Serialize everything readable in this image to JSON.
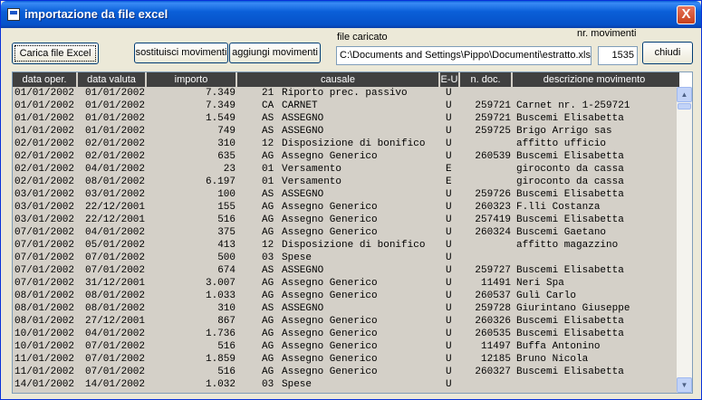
{
  "window": {
    "title": "importazione da file excel",
    "close_glyph": "X"
  },
  "toolbar": {
    "load_label": "Carica file Excel",
    "replace_label": "sostituisci movimenti",
    "add_label": "aggiungi movimenti",
    "close_label": "chiudi"
  },
  "file": {
    "label": "file caricato",
    "path": "C:\\Documents and Settings\\Pippo\\Documenti\\estratto.xls"
  },
  "movements": {
    "label": "nr. movimenti",
    "count": "1535"
  },
  "table": {
    "columns": [
      "data oper.",
      "data valuta",
      "importo",
      "causale",
      "E-U",
      "n. doc.",
      "descrizione movimento"
    ],
    "rows": [
      [
        "01/01/2002",
        "01/01/2002",
        "7.349",
        "21",
        "Riporto prec. passivo",
        "U",
        "",
        ""
      ],
      [
        "01/01/2002",
        "01/01/2002",
        "7.349",
        "CA",
        "CARNET",
        "U",
        "259721",
        "Carnet nr. 1-259721"
      ],
      [
        "01/01/2002",
        "01/01/2002",
        "1.549",
        "AS",
        "ASSEGNO",
        "U",
        "259721",
        "Buscemi Elisabetta"
      ],
      [
        "01/01/2002",
        "01/01/2002",
        "749",
        "AS",
        "ASSEGNO",
        "U",
        "259725",
        "Brigo Arrigo sas"
      ],
      [
        "02/01/2002",
        "02/01/2002",
        "310",
        "12",
        "Disposizione di bonifico",
        "U",
        "",
        "affitto ufficio"
      ],
      [
        "02/01/2002",
        "02/01/2002",
        "635",
        "AG",
        "Assegno Generico",
        "U",
        "260539",
        "Buscemi Elisabetta"
      ],
      [
        "02/01/2002",
        "04/01/2002",
        "23",
        "01",
        "Versamento",
        "E",
        "",
        "giroconto da cassa"
      ],
      [
        "02/01/2002",
        "08/01/2002",
        "6.197",
        "01",
        "Versamento",
        "E",
        "",
        "giroconto da cassa"
      ],
      [
        "03/01/2002",
        "03/01/2002",
        "100",
        "AS",
        "ASSEGNO",
        "U",
        "259726",
        "Buscemi Elisabetta"
      ],
      [
        "03/01/2002",
        "22/12/2001",
        "155",
        "AG",
        "Assegno Generico",
        "U",
        "260323",
        "F.lli Costanza"
      ],
      [
        "03/01/2002",
        "22/12/2001",
        "516",
        "AG",
        "Assegno Generico",
        "U",
        "257419",
        "Buscemi Elisabetta"
      ],
      [
        "07/01/2002",
        "04/01/2002",
        "375",
        "AG",
        "Assegno Generico",
        "U",
        "260324",
        "Buscemi Gaetano"
      ],
      [
        "07/01/2002",
        "05/01/2002",
        "413",
        "12",
        "Disposizione di bonifico",
        "U",
        "",
        "affitto magazzino"
      ],
      [
        "07/01/2002",
        "07/01/2002",
        "500",
        "03",
        "Spese",
        "U",
        "",
        ""
      ],
      [
        "07/01/2002",
        "07/01/2002",
        "674",
        "AS",
        "ASSEGNO",
        "U",
        "259727",
        "Buscemi Elisabetta"
      ],
      [
        "07/01/2002",
        "31/12/2001",
        "3.007",
        "AG",
        "Assegno Generico",
        "U",
        "11491",
        "Neri Spa"
      ],
      [
        "08/01/2002",
        "08/01/2002",
        "1.033",
        "AG",
        "Assegno Generico",
        "U",
        "260537",
        "Gulì Carlo"
      ],
      [
        "08/01/2002",
        "08/01/2002",
        "310",
        "AS",
        "ASSEGNO",
        "U",
        "259728",
        "Giurintano Giuseppe"
      ],
      [
        "08/01/2002",
        "27/12/2001",
        "867",
        "AG",
        "Assegno Generico",
        "U",
        "260326",
        "Buscemi Elisabetta"
      ],
      [
        "10/01/2002",
        "04/01/2002",
        "1.736",
        "AG",
        "Assegno Generico",
        "U",
        "260535",
        "Buscemi Elisabetta"
      ],
      [
        "10/01/2002",
        "07/01/2002",
        "516",
        "AG",
        "Assegno Generico",
        "U",
        "11497",
        "Buffa Antonino"
      ],
      [
        "11/01/2002",
        "07/01/2002",
        "1.859",
        "AG",
        "Assegno Generico",
        "U",
        "12185",
        "Bruno Nicola"
      ],
      [
        "11/01/2002",
        "07/01/2002",
        "516",
        "AG",
        "Assegno Generico",
        "U",
        "260327",
        "Buscemi Elisabetta"
      ],
      [
        "14/01/2002",
        "14/01/2002",
        "1.032",
        "03",
        "Spese",
        "U",
        "",
        ""
      ]
    ]
  },
  "scrollbar": {
    "up_glyph": "▲",
    "down_glyph": "▼"
  }
}
